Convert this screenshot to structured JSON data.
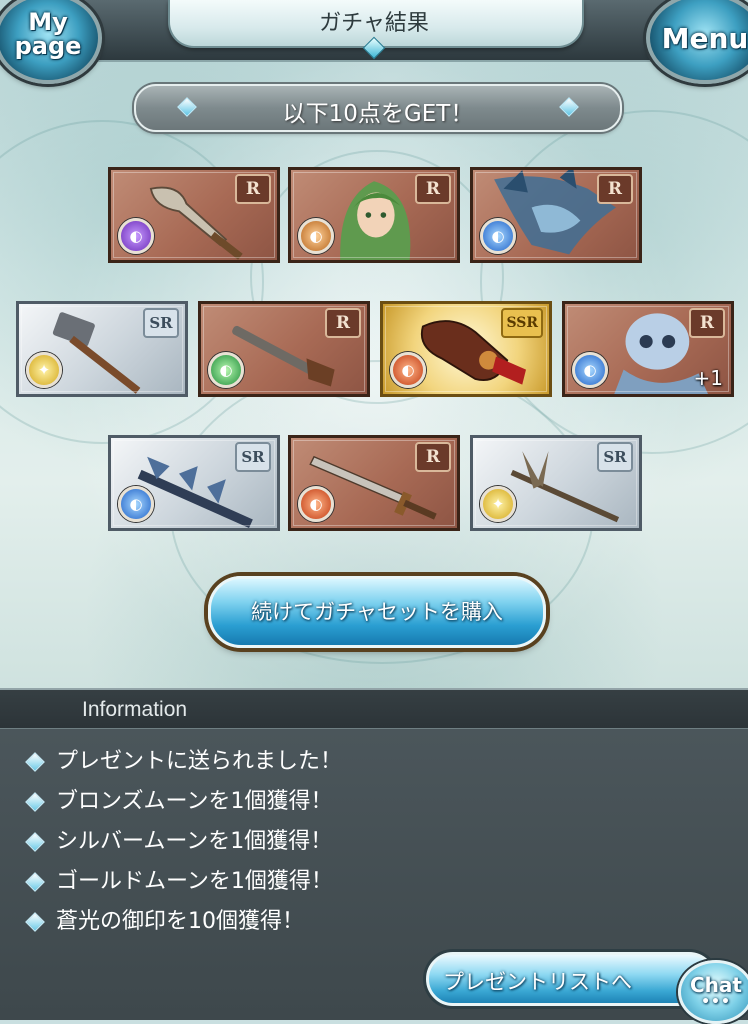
{
  "header": {
    "title": "ガチャ結果",
    "mypage_line1": "My",
    "mypage_line2": "page",
    "menu_label": "Menu"
  },
  "banner": {
    "text": "以下10点をGET！"
  },
  "cards": [
    {
      "rarity": "R",
      "element": "dark",
      "element_glyph": "◐",
      "art": "dagger-weapon",
      "plus": ""
    },
    {
      "rarity": "R",
      "element": "earth",
      "element_glyph": "◐",
      "art": "green-haired-character",
      "plus": ""
    },
    {
      "rarity": "R",
      "element": "water",
      "element_glyph": "◐",
      "art": "sea-dragon-summon",
      "plus": ""
    },
    {
      "rarity": "SR",
      "element": "light",
      "element_glyph": "✦",
      "art": "war-hammer-weapon",
      "plus": ""
    },
    {
      "rarity": "R",
      "element": "wind",
      "element_glyph": "◐",
      "art": "pistol-weapon",
      "plus": ""
    },
    {
      "rarity": "SSR",
      "element": "fire",
      "element_glyph": "◐",
      "art": "gauntlet-weapon",
      "plus": ""
    },
    {
      "rarity": "R",
      "element": "water",
      "element_glyph": "◐",
      "art": "skeleton-knight-summon",
      "plus": "+1"
    },
    {
      "rarity": "SR",
      "element": "water",
      "element_glyph": "◐",
      "art": "spiked-spear-weapon",
      "plus": ""
    },
    {
      "rarity": "R",
      "element": "fire",
      "element_glyph": "◐",
      "art": "long-sword-weapon",
      "plus": ""
    },
    {
      "rarity": "SR",
      "element": "light",
      "element_glyph": "✦",
      "art": "trident-spear-weapon",
      "plus": ""
    }
  ],
  "buy_button": {
    "label": "続けてガチャセットを購入"
  },
  "information": {
    "title": "Information",
    "items": [
      "プレゼントに送られました！",
      "ブロンズムーンを1個獲得！",
      "シルバームーンを1個獲得！",
      "ゴールドムーンを1個獲得！",
      "蒼光の御印を10個獲得！"
    ]
  },
  "present_button": {
    "label": "プレゼントリストへ"
  },
  "chat_button": {
    "label": "Chat",
    "dots": "•••"
  },
  "colors": {
    "accent_blue": "#2b9fd2",
    "r_card": "#a86a55",
    "sr_card": "#ccd5dc",
    "ssr_card": "#f2d57e",
    "panel_bg": "#4d585d"
  }
}
